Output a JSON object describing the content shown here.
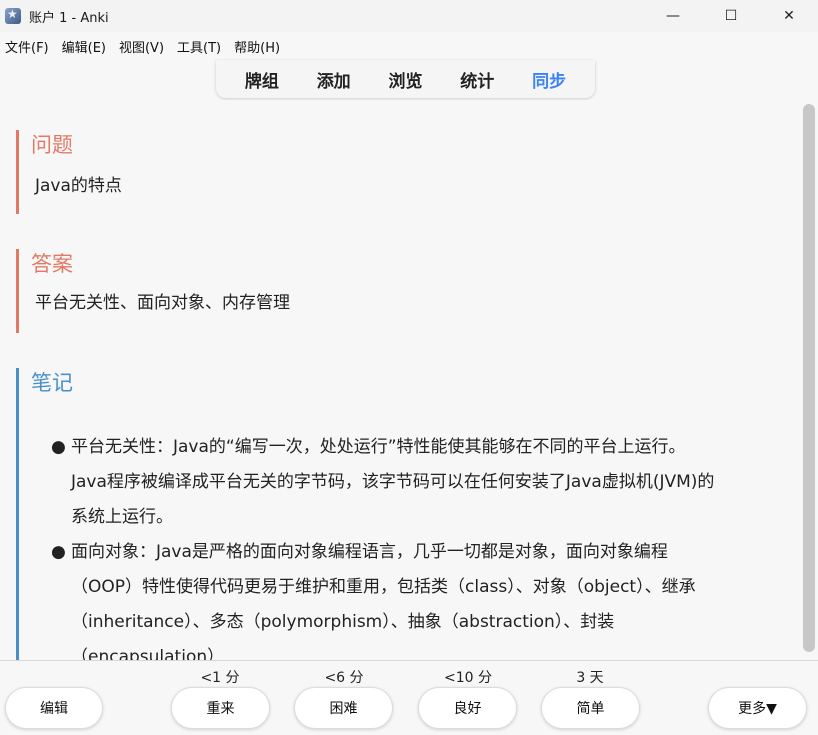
{
  "window": {
    "title": "账户 1 - Anki",
    "controls": {
      "minimize": "—",
      "maximize": "☐",
      "close": "✕"
    }
  },
  "menu": {
    "items": [
      "文件(F)",
      "编辑(E)",
      "视图(V)",
      "工具(T)",
      "帮助(H)"
    ]
  },
  "toolbar": {
    "links": [
      "牌组",
      "添加",
      "浏览",
      "统计",
      "同步"
    ],
    "active": "同步",
    "active_color": "#3b82f6"
  },
  "card": {
    "question": {
      "heading": "问题",
      "text": "Java的特点"
    },
    "answer": {
      "heading": "答案",
      "text": "平台无关性、面向对象、内存管理"
    },
    "note": {
      "heading": "笔记",
      "items": [
        "平台无关性：Java的“编写一次，处处运行”特性能使其能够在不同的平台上运行。Java程序被编译成平台无关的字节码，该字节码可以在任何安装了Java虚拟机(JVM)的系统上运行。",
        "面向对象：Java是严格的面向对象编程语言，几乎一切都是对象，面向对象编程（OOP）特性使得代码更易于维护和重用，包括类（class）、对象（object）、继承（inheritance）、多态（polymorphism）、抽象（abstraction）、封装（encapsulation）"
      ]
    },
    "colors": {
      "question_accent": "#e07a67",
      "note_accent": "#4a90c8"
    }
  },
  "bottom": {
    "edit_label": "编辑",
    "more_label": "更多▼",
    "ease": [
      {
        "interval": "<1 分",
        "label": "重来"
      },
      {
        "interval": "<6 分",
        "label": "困难"
      },
      {
        "interval": "<10 分",
        "label": "良好"
      },
      {
        "interval": "3 天",
        "label": "简单"
      }
    ]
  }
}
